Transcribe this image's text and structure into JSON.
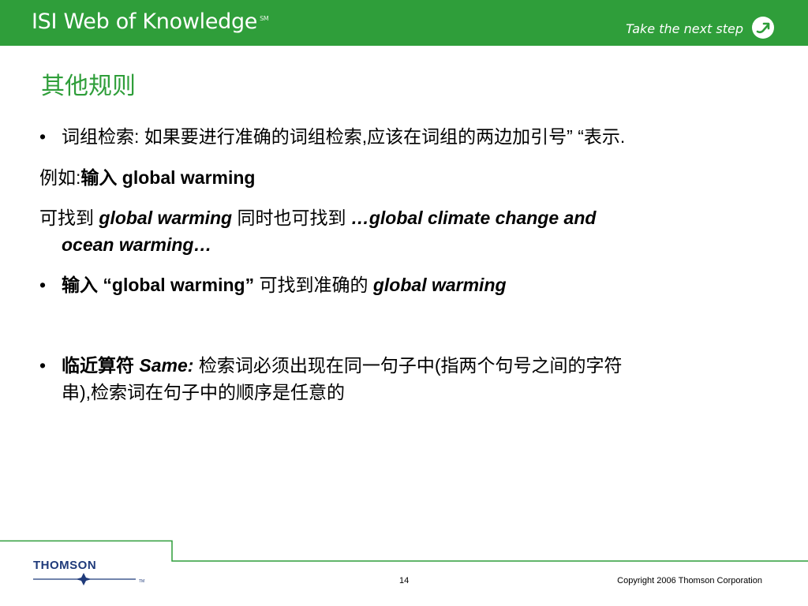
{
  "header": {
    "title": "ISI Web of Knowledge",
    "title_mark": "SM",
    "tagline": "Take the next step",
    "color": "#2f9e3a"
  },
  "slide": {
    "title": "其他规则",
    "lines": {
      "l1_bullet": "•",
      "l1_text": "词组检索:  如果要进行准确的词组检索,应该在词组的两边加引号” “表示.",
      "l2_prefix": "例如:",
      "l2_bold": "输入 global warming",
      "l3_prefix": "可找到 ",
      "l3_bi1": "global warming",
      "l3_mid": " 同时也可找到 ",
      "l3_bi2": "…global climate change and",
      "l4_bi": "ocean warming…",
      "l5_bullet": "•",
      "l5_bold": "输入 “global warming”",
      "l5_mid": "  可找到准确的 ",
      "l5_bi": "global warming",
      "l6_bullet": "•",
      "l6_bold": "临近算符 ",
      "l6_bi": "Same:",
      "l6_text": "  检索词必须出现在同一句子中(指两个句号之间的字符",
      "l7_text": "串),检索词在句子中的顺序是任意的"
    }
  },
  "footer": {
    "logo_text": "THOMSON",
    "logo_tm": "TM",
    "page_number": "14",
    "copyright": "Copyright 2006 Thomson Corporation"
  }
}
